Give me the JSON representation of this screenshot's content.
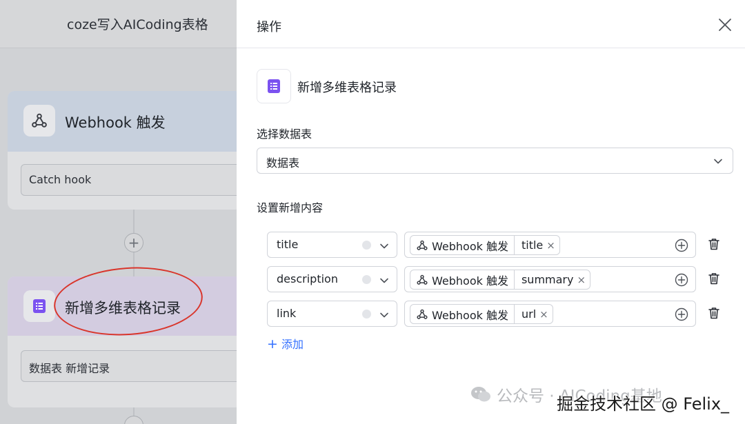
{
  "canvas": {
    "title": "coze写入AICoding表格",
    "node1": {
      "title": "Webhook 触发",
      "field": "Catch hook",
      "icon": "webhook-icon"
    },
    "node2": {
      "title": "新增多维表格记录",
      "field": "数据表 新增记录",
      "icon": "table-list-icon"
    },
    "add_symbol": "+"
  },
  "panel": {
    "title": "操作",
    "action_title": "新增多维表格记录",
    "select_label": "选择数据表",
    "select_value": "数据表",
    "content_label": "设置新增内容",
    "rows": [
      {
        "field": "title",
        "source": "Webhook 触发",
        "variable": "title"
      },
      {
        "field": "description",
        "source": "Webhook 触发",
        "variable": "summary"
      },
      {
        "field": "link",
        "source": "Webhook 触发",
        "variable": "url"
      }
    ],
    "add_label": "添加",
    "remove_symbol": "×"
  },
  "watermark": {
    "wechat": "公众号 · AICoding基地",
    "juejin": "掘金技术社区 @ Felix_"
  },
  "colors": {
    "accent": "#3370ff",
    "table_icon": "#7b52f0",
    "highlight_oval": "#d9352b"
  }
}
